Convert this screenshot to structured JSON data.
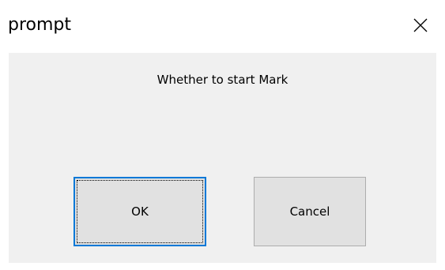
{
  "window": {
    "title": "prompt",
    "close_icon": "close-icon"
  },
  "dialog": {
    "message": "Whether to start Mark"
  },
  "buttons": {
    "ok_label": "OK",
    "cancel_label": "Cancel"
  },
  "colors": {
    "focus_border": "#0078d7",
    "body_background": "#f0f0f0",
    "button_background": "#e1e1e1"
  }
}
